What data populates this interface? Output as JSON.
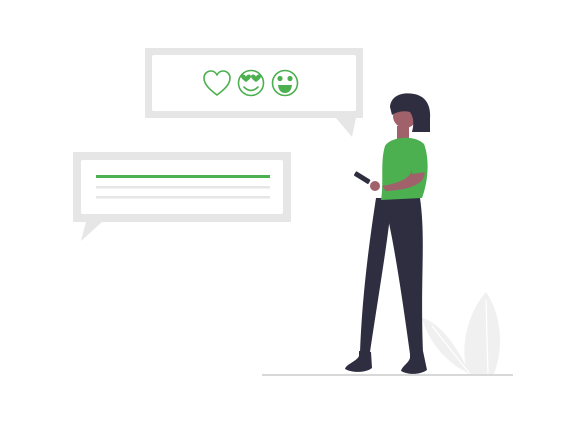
{
  "colors": {
    "accent": "#4caf50",
    "bubble": "#e6e6e6",
    "bubble_inner": "#ffffff",
    "line_gray": "#e0e0e0",
    "skin": "#a0616a",
    "hair": "#2f2e41",
    "pants": "#2f2e41",
    "ground": "#cccccc",
    "plant": "#f0f0f0"
  },
  "icons": {
    "reaction_bubble": [
      "heart-icon",
      "heart-eyes-emoji-icon",
      "grinning-emoji-icon"
    ],
    "message_bubble": [
      "text-line-accent",
      "text-line",
      "text-line"
    ]
  }
}
